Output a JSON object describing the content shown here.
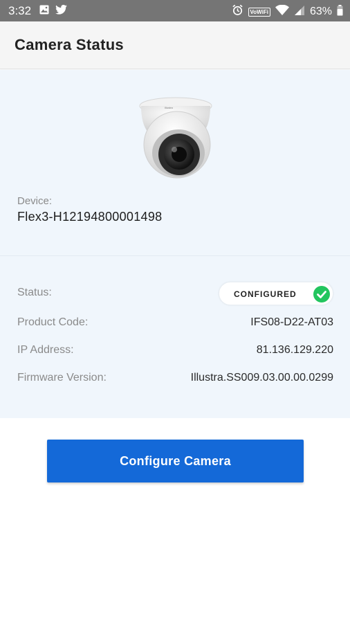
{
  "status_bar": {
    "time": "3:32",
    "left_icons": [
      "image-icon",
      "twitter-icon"
    ],
    "right_icons": [
      "alarm-icon",
      "vowifi-icon",
      "wifi-icon",
      "signal-icon",
      "battery-icon"
    ],
    "vowifi_label": "VoWiFi",
    "battery_percent": "63%"
  },
  "header": {
    "title": "Camera Status"
  },
  "device": {
    "label": "Device:",
    "name": "Flex3-H12194800001498"
  },
  "details": {
    "status_label": "Status:",
    "status_value": "CONFIGURED",
    "product_code_label": "Product Code:",
    "product_code_value": "IFS08-D22-AT03",
    "ip_label": "IP Address:",
    "ip_value": "81.136.129.220",
    "firmware_label": "Firmware Version:",
    "firmware_value": "Illustra.SS009.03.00.00.0299"
  },
  "action": {
    "configure_label": "Configure Camera"
  },
  "colors": {
    "accent": "#1469d8",
    "status_ok": "#22c55e",
    "card_bg": "#f0f6fc",
    "status_bar_bg": "#757575"
  }
}
